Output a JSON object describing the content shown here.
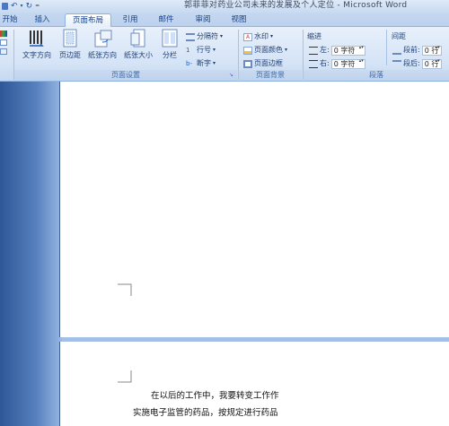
{
  "titlebar": {
    "title": "郭菲菲对药业公司未来的发展及个人定位 - Microsoft Word"
  },
  "tabs": [
    {
      "label": "开始",
      "active": false
    },
    {
      "label": "插入",
      "active": false
    },
    {
      "label": "页面布局",
      "active": true
    },
    {
      "label": "引用",
      "active": false
    },
    {
      "label": "邮件",
      "active": false
    },
    {
      "label": "审阅",
      "active": false
    },
    {
      "label": "视图",
      "active": false
    }
  ],
  "ribbon": {
    "page_setup": {
      "group_label": "页面设置",
      "text_direction": "文字方向",
      "margins": "页边距",
      "orientation": "纸张方向",
      "size": "纸张大小",
      "columns": "分栏",
      "breaks": "分隔符",
      "line_numbers": "行号",
      "hyphenation": "断字"
    },
    "page_background": {
      "group_label": "页面背景",
      "watermark": "水印",
      "page_color": "页面颜色",
      "page_borders": "页面边框"
    },
    "paragraph": {
      "group_label": "段落",
      "indent_label": "缩进",
      "indent_left_label": "左:",
      "indent_left_value": "0 字符",
      "indent_right_label": "右:",
      "indent_right_value": "0 字符",
      "spacing_label": "间距",
      "spacing_before_label": "段前:",
      "spacing_before_value": "0 行",
      "spacing_after_label": "段后:",
      "spacing_after_value": "0 行"
    }
  },
  "document": {
    "line1": "在以后的工作中，我要转变工作作",
    "line2": "实施电子监管的药品，按规定进行药品"
  },
  "colors": {
    "ribbon_text": "#15428b",
    "doc_background": "#a4c0e6",
    "sidebar_dark": "#2e5797"
  }
}
